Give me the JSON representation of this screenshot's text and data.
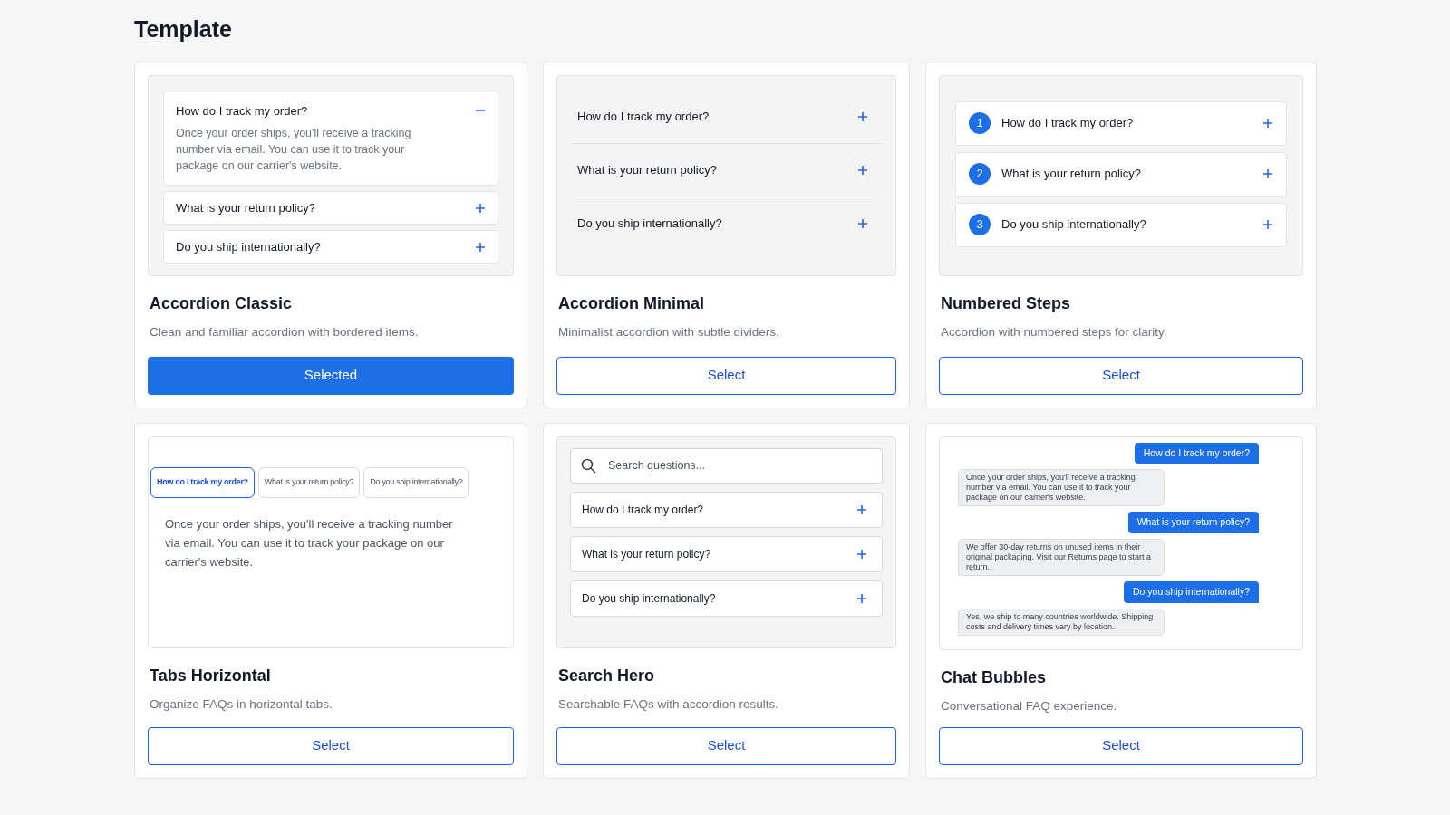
{
  "page_title": "Template",
  "templates": [
    {
      "kind": "classic",
      "title": "Accordion Classic",
      "description": "Clean and familiar accordion with bordered items.",
      "button": "Selected",
      "selected": true,
      "items": [
        {
          "question": "How do I track my order?",
          "expanded": true,
          "answer": "Once your order ships, you'll receive a tracking number via email. You can use it to track your package on our carrier's website."
        },
        {
          "question": "What is your return policy?",
          "expanded": false
        },
        {
          "question": "Do you ship internationally?",
          "expanded": false
        }
      ]
    },
    {
      "kind": "minimal",
      "title": "Accordion Minimal",
      "description": "Minimalist accordion with subtle dividers.",
      "button": "Select",
      "selected": false,
      "items": [
        {
          "question": "How do I track my order?",
          "expanded": false
        },
        {
          "question": "What is your return policy?",
          "expanded": false
        },
        {
          "question": "Do you ship internationally?",
          "expanded": false
        }
      ]
    },
    {
      "kind": "numbered",
      "title": "Numbered Steps",
      "description": "Accordion with numbered steps for clarity.",
      "button": "Select",
      "selected": false,
      "items": [
        {
          "number": "1",
          "question": "How do I track my order?",
          "expanded": false
        },
        {
          "number": "2",
          "question": "What is your return policy?",
          "expanded": false
        },
        {
          "number": "3",
          "question": "Do you ship internationally?",
          "expanded": false
        }
      ]
    },
    {
      "kind": "tabs",
      "title": "Tabs Horizontal",
      "description": "Organize FAQs in horizontal tabs.",
      "button": "Select",
      "selected": false,
      "tabs": [
        {
          "label": "How do I track my order?",
          "selected": true
        },
        {
          "label": "What is your return policy?",
          "selected": false
        },
        {
          "label": "Do you ship internationally?",
          "selected": false
        }
      ],
      "answer": "Once your order ships, you'll receive a tracking number via email. You can use it to track your package on our carrier's website."
    },
    {
      "kind": "search",
      "title": "Search Hero",
      "description": "Searchable FAQs with accordion results.",
      "button": "Select",
      "selected": false,
      "search": {
        "placeholder": "Search questions..."
      },
      "items": [
        {
          "question": "How do I track my order?",
          "expanded": false
        },
        {
          "question": "What is your return policy?",
          "expanded": false
        },
        {
          "question": "Do you ship internationally?",
          "expanded": false
        }
      ]
    },
    {
      "kind": "chat",
      "title": "Chat Bubbles",
      "description": "Conversational FAQ experience.",
      "button": "Select",
      "selected": false,
      "messages": [
        {
          "kind": "user",
          "text": "How do I track my order?"
        },
        {
          "kind": "bot",
          "text": "Once your order ships, you'll receive a tracking number via email. You can use it to track your package on our carrier's website."
        },
        {
          "kind": "user",
          "text": "What is your return policy?"
        },
        {
          "kind": "bot",
          "text": "We offer 30-day returns on unused items in their original packaging. Visit our Returns page to start a return."
        },
        {
          "kind": "user",
          "text": "Do you ship internationally?"
        },
        {
          "kind": "bot",
          "text": "Yes, we ship to many countries worldwide. Shipping costs and delivery times vary by location."
        }
      ]
    }
  ]
}
